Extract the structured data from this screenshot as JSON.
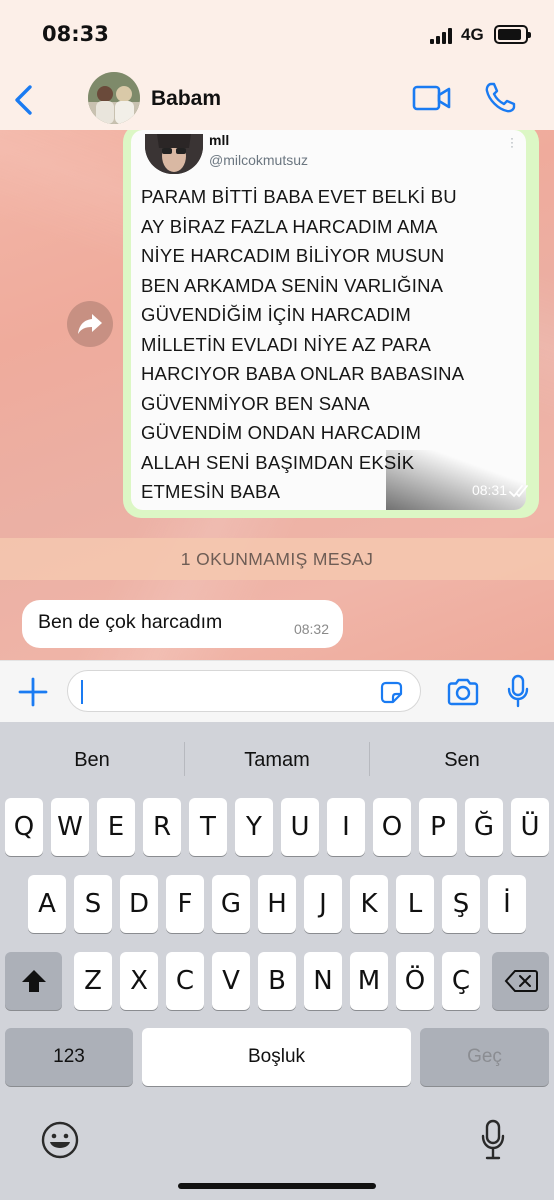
{
  "status_bar": {
    "time": "08:33",
    "network": "4G",
    "battery_level": 0.9,
    "signal_bars": 4
  },
  "header": {
    "back_icon": "chevron-left-icon",
    "contact_name": "Babam",
    "video_icon": "video-camera-icon",
    "call_icon": "phone-icon"
  },
  "chat": {
    "outgoing_message": {
      "tweet": {
        "name": "mll",
        "handle": "@milcokmutsuz",
        "lines": [
          "PARAM BİTTİ BABA EVET BELKİ BU",
          "AY BİRAZ FAZLA HARCADIM AMA",
          "NİYE HARCADIM BİLİYOR MUSUN",
          "BEN ARKAMDA SENİN VARLIĞINA",
          "GÜVENDİĞİM İÇİN HARCADIM",
          "MİLLETİN EVLADI NİYE AZ PARA",
          "HARCIYOR BABA ONLAR BABASINA",
          "GÜVENMİYOR BEN SANA",
          "GÜVENDİM ONDAN HARCADIM",
          "ALLAH SENİ BAŞIMDAN EKSİK",
          "ETMESİN BABA"
        ]
      },
      "time": "08:31",
      "status_icon": "double-check-icon"
    },
    "forward_icon": "forward-icon",
    "unread_banner": "1 OKUNMAMIŞ MESAJ",
    "incoming_message": {
      "text": "Ben de çok harcadım",
      "time": "08:32"
    }
  },
  "input_bar": {
    "plus_icon": "plus-icon",
    "value": "",
    "sticker_icon": "sticker-icon",
    "camera_icon": "camera-icon",
    "mic_icon": "microphone-icon"
  },
  "keyboard": {
    "suggestions": [
      "Ben",
      "Tamam",
      "Sen"
    ],
    "row1": [
      "Q",
      "W",
      "E",
      "R",
      "T",
      "Y",
      "U",
      "I",
      "O",
      "P",
      "Ğ",
      "Ü"
    ],
    "row2": [
      "A",
      "S",
      "D",
      "F",
      "G",
      "H",
      "J",
      "K",
      "L",
      "Ş",
      "İ"
    ],
    "row3": [
      "Z",
      "X",
      "C",
      "V",
      "B",
      "N",
      "M",
      "Ö",
      "Ç"
    ],
    "numbers_key": "123",
    "space_key": "Boşluk",
    "return_key": "Geç",
    "shift_icon": "shift-icon",
    "delete_icon": "backspace-icon",
    "emoji_icon": "emoji-icon",
    "dictation_icon": "microphone-icon"
  },
  "colors": {
    "accent": "#1a7bf2",
    "outgoing_bubble": "#dcf7c5",
    "incoming_bubble": "#ffffff"
  }
}
